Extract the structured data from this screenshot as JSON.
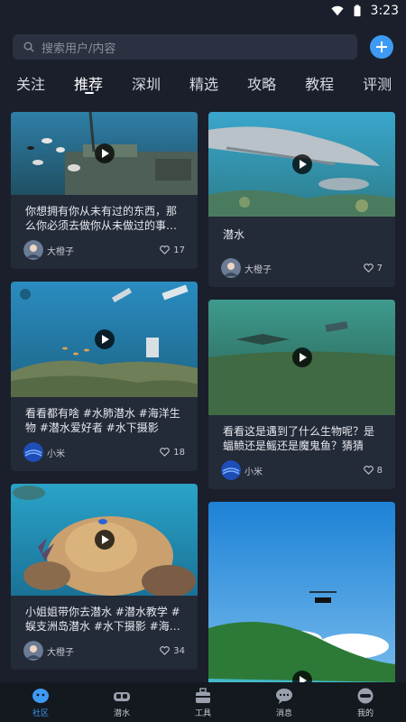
{
  "status": {
    "time": "3:23"
  },
  "search": {
    "placeholder": "搜索用户/内容"
  },
  "tabs": [
    {
      "label": "关注"
    },
    {
      "label": "推荐"
    },
    {
      "label": "深圳"
    },
    {
      "label": "精选"
    },
    {
      "label": "攻略"
    },
    {
      "label": "教程"
    },
    {
      "label": "评测"
    }
  ],
  "active_tab": "推荐",
  "feed": {
    "left": [
      {
        "text": "你想拥有你从未有过的东西，那么你必须去做你从未做过的事…",
        "author": "大橙子",
        "likes": "17"
      },
      {
        "text": "看看都有啥 #水肺潜水 #海洋生物 #潜水爱好者 #水下摄影",
        "author": "小米",
        "likes": "18"
      },
      {
        "text": "小姐姐带你去潜水 #潜水教学 #蜈支洲岛潜水 #水下摄影 #海…",
        "author": "大橙子",
        "likes": "34"
      }
    ],
    "right": [
      {
        "text": "潜水",
        "author": "大橙子",
        "likes": "7"
      },
      {
        "text": "看看这是遇到了什么生物呢？是蝠鲼还是鳐还是魔鬼鱼？猜猜 #…",
        "author": "小米",
        "likes": "8"
      }
    ]
  },
  "bottom_nav": [
    {
      "label": "社区",
      "icon": "community-icon"
    },
    {
      "label": "潜水",
      "icon": "diving-mask-icon"
    },
    {
      "label": "工具",
      "icon": "toolbox-icon"
    },
    {
      "label": "消息",
      "icon": "message-icon"
    },
    {
      "label": "我的",
      "icon": "profile-icon"
    }
  ],
  "colors": {
    "accent": "#3e9bf5",
    "background": "#1a1f2b",
    "card": "#232a38"
  }
}
